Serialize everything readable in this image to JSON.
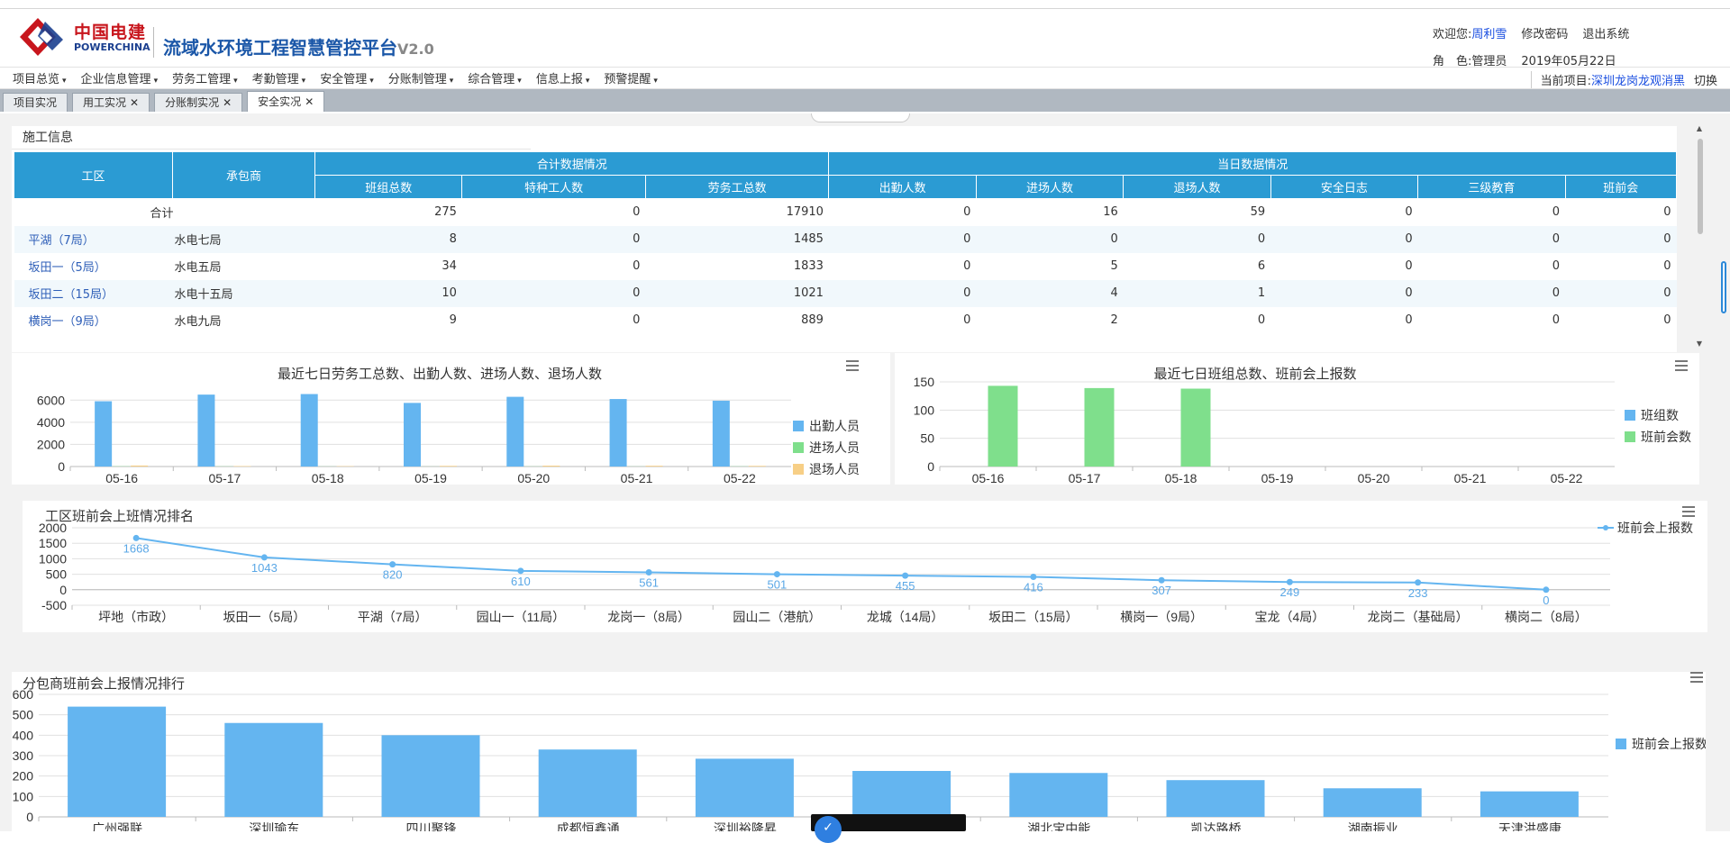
{
  "header": {
    "brand_cn": "中国电建",
    "brand_en": "POWERCHINA",
    "system_name": "流域水环境工程智慧管控平台",
    "version": "V2.0",
    "welcome_label": "欢迎您:",
    "user_name": "周利雪",
    "change_password": "修改密码",
    "logout": "退出系统",
    "role_label": "角　色:",
    "role": "管理员",
    "date": "2019年05月22日",
    "colors": {
      "brand_red": "#c8161d",
      "brand_blue": "#1b3f8f",
      "title_blue": "#1b57a8"
    }
  },
  "menu": {
    "items": [
      {
        "label": "项目总览"
      },
      {
        "label": "企业信息管理"
      },
      {
        "label": "劳务工管理"
      },
      {
        "label": "考勤管理"
      },
      {
        "label": "安全管理"
      },
      {
        "label": "分账制管理"
      },
      {
        "label": "综合管理"
      },
      {
        "label": "信息上报"
      },
      {
        "label": "预警提醒"
      }
    ],
    "caret": "▾",
    "current_project_label": "当前项目:",
    "current_project": "深圳龙岗龙观消黑",
    "switch_label": "切换"
  },
  "tabs": [
    {
      "label": "项目实况",
      "closable": false
    },
    {
      "label": "用工实况",
      "closable": true
    },
    {
      "label": "分账制实况",
      "closable": true
    },
    {
      "label": "安全实况",
      "closable": true,
      "active": true
    }
  ],
  "tab_close_glyph": "✕",
  "construction": {
    "title": "施工信息",
    "group_headers": {
      "area": "工区",
      "contractor": "承包商",
      "total_group": "合计数据情况",
      "today_group": "当日数据情况"
    },
    "columns": [
      "班组总数",
      "特种工人数",
      "劳务工总数",
      "出勤人数",
      "进场人数",
      "退场人数",
      "安全日志",
      "三级教育",
      "班前会"
    ],
    "total_row": {
      "label": "合计",
      "values": [
        "275",
        "0",
        "17910",
        "0",
        "16",
        "59",
        "0",
        "0",
        "0"
      ]
    },
    "rows": [
      {
        "area": "平湖（7局）",
        "contractor": "水电七局",
        "values": [
          "8",
          "0",
          "1485",
          "0",
          "0",
          "0",
          "0",
          "0",
          "0"
        ]
      },
      {
        "area": "坂田一（5局）",
        "contractor": "水电五局",
        "values": [
          "34",
          "0",
          "1833",
          "0",
          "5",
          "6",
          "0",
          "0",
          "0"
        ]
      },
      {
        "area": "坂田二（15局）",
        "contractor": "水电十五局",
        "values": [
          "10",
          "0",
          "1021",
          "0",
          "4",
          "1",
          "0",
          "0",
          "0"
        ]
      },
      {
        "area": "横岗一（9局）",
        "contractor": "水电九局",
        "values": [
          "9",
          "0",
          "889",
          "0",
          "2",
          "0",
          "0",
          "0",
          "0"
        ]
      }
    ],
    "header_color": "#2b9bd3"
  },
  "chart_data": [
    {
      "id": "chart1",
      "type": "bar",
      "title": "最近七日劳务工总数、出勤人数、进场人数、退场人数",
      "categories": [
        "05-16",
        "05-17",
        "05-18",
        "05-19",
        "05-20",
        "05-21",
        "05-22"
      ],
      "series": [
        {
          "name": "出勤人员",
          "color": "#64b5f0",
          "values": [
            5900,
            6500,
            6550,
            5750,
            6300,
            6100,
            5950
          ]
        },
        {
          "name": "进场人员",
          "color": "#7fdf8c",
          "values": [
            20,
            15,
            10,
            8,
            12,
            10,
            16
          ]
        },
        {
          "name": "退场人员",
          "color": "#f7cf86",
          "values": [
            90,
            40,
            30,
            60,
            80,
            70,
            59
          ]
        }
      ],
      "yticks": [
        "0",
        "2000",
        "4000",
        "6000"
      ],
      "ylim": [
        0,
        7000
      ],
      "legend": "right",
      "grid": true
    },
    {
      "id": "chart2",
      "type": "bar",
      "title": "最近七日班组总数、班前会上报数",
      "categories": [
        "05-16",
        "05-17",
        "05-18",
        "05-19",
        "05-20",
        "05-21",
        "05-22"
      ],
      "series": [
        {
          "name": "班组数",
          "color": "#64b5f0",
          "values": [
            0,
            0,
            0,
            0,
            0,
            0,
            0
          ]
        },
        {
          "name": "班前会数",
          "color": "#7fdf8c",
          "values": [
            143,
            139,
            138,
            0,
            0,
            0,
            0
          ]
        }
      ],
      "yticks": [
        "0",
        "50",
        "100",
        "150"
      ],
      "ylim": [
        0,
        150
      ],
      "legend": "right",
      "grid": true
    },
    {
      "id": "chart3",
      "type": "line",
      "title": "工区班前会上班情况排名",
      "categories": [
        "坪地（市政）",
        "坂田一（5局）",
        "平湖（7局）",
        "园山一（11局）",
        "龙岗一（8局）",
        "园山二（港航）",
        "龙城（14局）",
        "坂田二（15局）",
        "横岗一（9局）",
        "宝龙（4局）",
        "龙岗二（基础局）",
        "横岗二（8局）"
      ],
      "series": [
        {
          "name": "班前会上报数",
          "color": "#64b5f0",
          "values": [
            1668,
            1043,
            820,
            610,
            561,
            501,
            455,
            416,
            307,
            249,
            233,
            0
          ]
        }
      ],
      "yticks": [
        "-500",
        "0",
        "500",
        "1000",
        "1500",
        "2000"
      ],
      "ylim": [
        -500,
        2000
      ],
      "legend": "right",
      "grid": true
    },
    {
      "id": "chart4",
      "type": "bar",
      "title": "分包商班前会上报情况排行",
      "categories": [
        "广州强联",
        "深圳瑜东",
        "四川聚锋",
        "成都恒鑫通",
        "深圳裕隆昇",
        "",
        "湖北宝中能",
        "凯达路桥",
        "湖南振业",
        "天津洪盛康"
      ],
      "series": [
        {
          "name": "班前会上报数",
          "color": "#64b5f0",
          "values": [
            540,
            460,
            400,
            330,
            285,
            225,
            215,
            180,
            140,
            125
          ]
        }
      ],
      "yticks": [
        "0",
        "100",
        "200",
        "300",
        "400",
        "500",
        "600"
      ],
      "ylim": [
        0,
        600
      ],
      "legend": "right",
      "grid": true
    }
  ]
}
